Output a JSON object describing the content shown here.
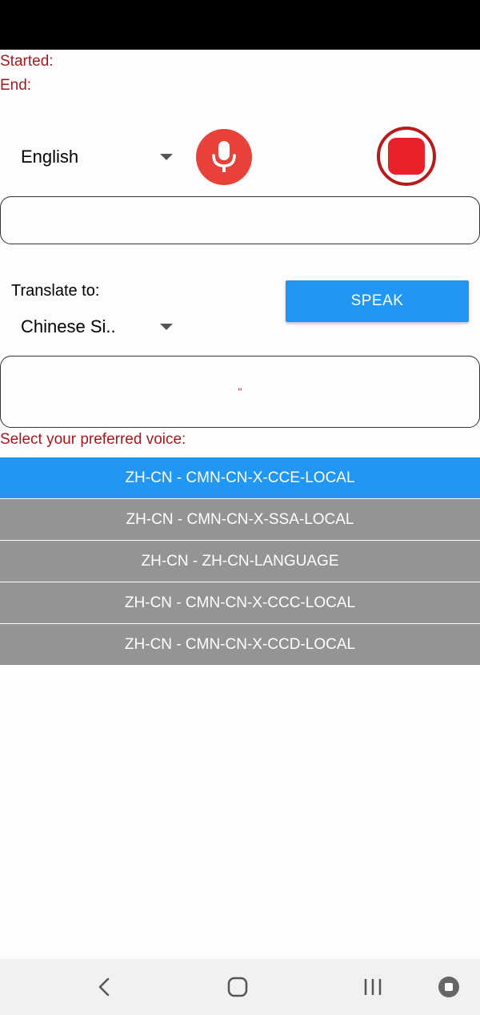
{
  "status": {
    "started_label": "Started:",
    "end_label": "End:"
  },
  "source": {
    "language": "English",
    "input_value": "",
    "input_placeholder": ""
  },
  "target": {
    "label": "Translate to:",
    "language": "Chinese Si..",
    "output_text": "\""
  },
  "controls": {
    "mic_icon": "microphone-icon",
    "stop_icon": "stop-icon",
    "speak_label": "SPEAK"
  },
  "voices": {
    "prompt": "Select your preferred voice:",
    "options": [
      {
        "label": "ZH-CN - CMN-CN-X-CCE-LOCAL",
        "selected": true
      },
      {
        "label": "ZH-CN - CMN-CN-X-SSA-LOCAL",
        "selected": false
      },
      {
        "label": "ZH-CN - ZH-CN-LANGUAGE",
        "selected": false
      },
      {
        "label": "ZH-CN - CMN-CN-X-CCC-LOCAL",
        "selected": false
      },
      {
        "label": "ZH-CN - CMN-CN-X-CCD-LOCAL",
        "selected": false
      }
    ]
  },
  "colors": {
    "accent": "#2196f3",
    "status_text": "#9e1b1b",
    "mic": "#e8413a",
    "stop": "#e8212a",
    "unselected": "#959395"
  }
}
